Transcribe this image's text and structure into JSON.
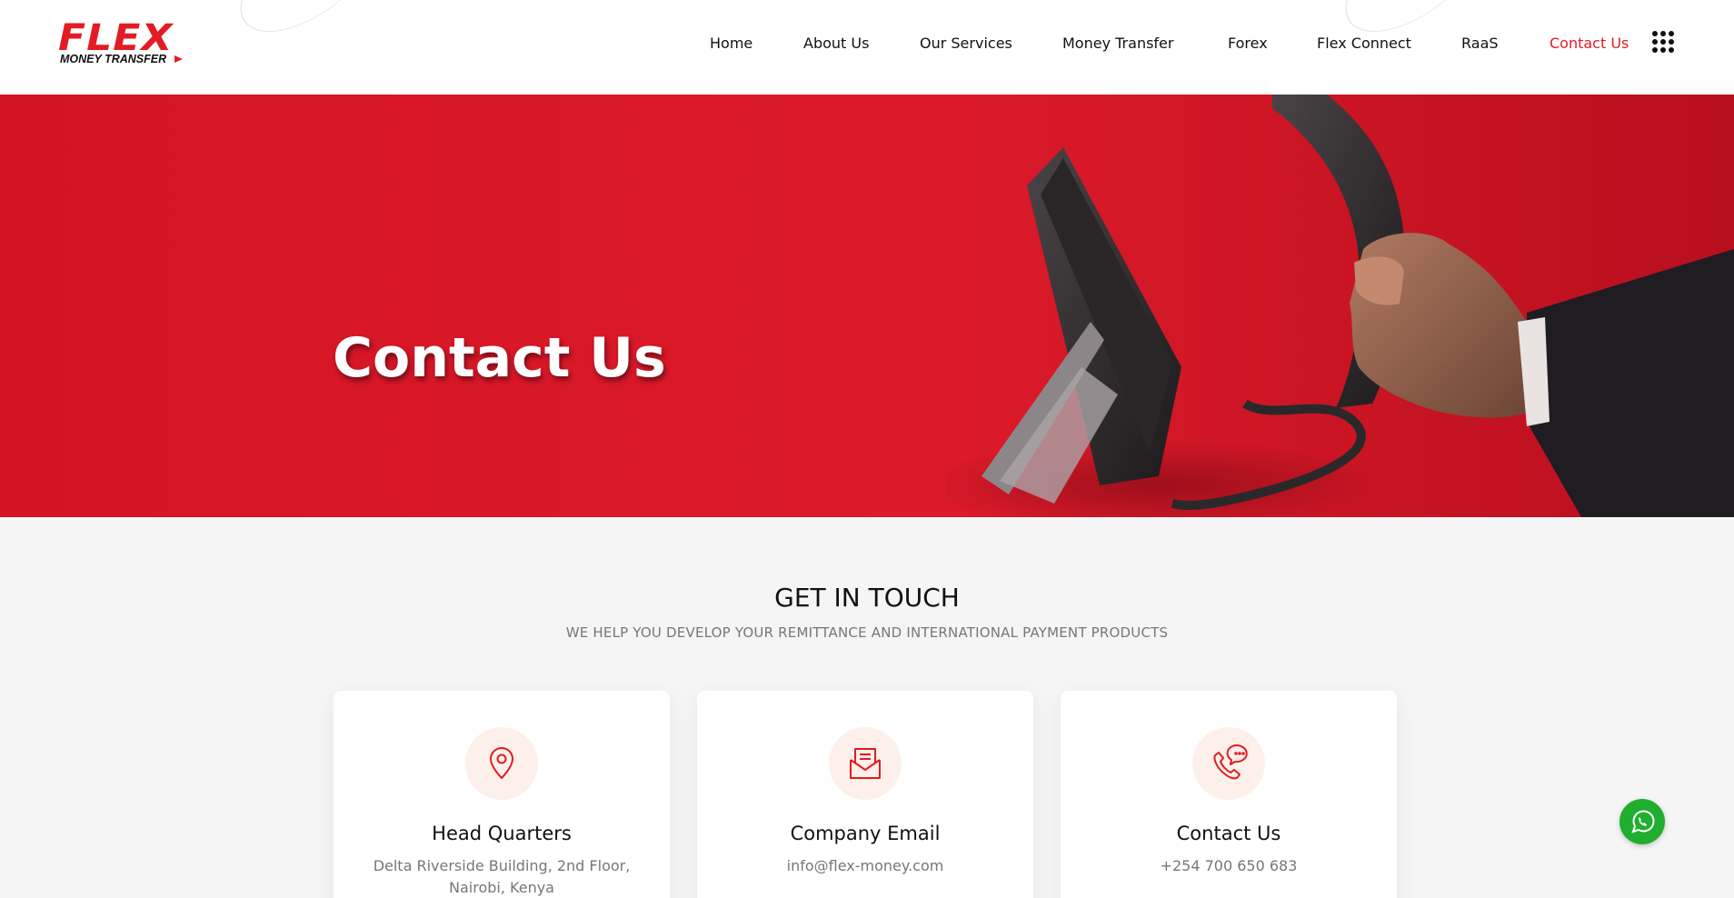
{
  "brand": {
    "name": "FLEX",
    "tagline": "MONEY TRANSFER",
    "accent_color": "#e31b23"
  },
  "nav": {
    "items": [
      {
        "label": "Home",
        "active": false
      },
      {
        "label": "About Us",
        "active": false
      },
      {
        "label": "Our Services",
        "active": false
      },
      {
        "label": "Money Transfer",
        "active": false
      },
      {
        "label": "Forex",
        "active": false
      },
      {
        "label": "Flex Connect",
        "active": false
      },
      {
        "label": "RaaS",
        "active": false
      },
      {
        "label": "Contact Us",
        "active": true
      }
    ],
    "menu_icon": "grid-dots-icon"
  },
  "hero": {
    "title": "Contact Us",
    "background_color": "#d41424",
    "image": "hand-holding-phone-receiver"
  },
  "touch": {
    "title": "GET IN TOUCH",
    "subtitle": "WE HELP YOU DEVELOP YOUR REMITTANCE AND INTERNATIONAL PAYMENT PRODUCTS"
  },
  "cards": [
    {
      "icon": "map-pin-icon",
      "title": "Head Quarters",
      "text": "Delta Riverside Building, 2nd Floor, Nairobi, Kenya"
    },
    {
      "icon": "envelope-icon",
      "title": "Company Email",
      "text": "info@flex-money.com"
    },
    {
      "icon": "phone-chat-icon",
      "title": "Contact Us",
      "text": "+254 700 650 683"
    }
  ],
  "floating": {
    "icon": "whatsapp-icon",
    "color": "#1fae2e"
  }
}
